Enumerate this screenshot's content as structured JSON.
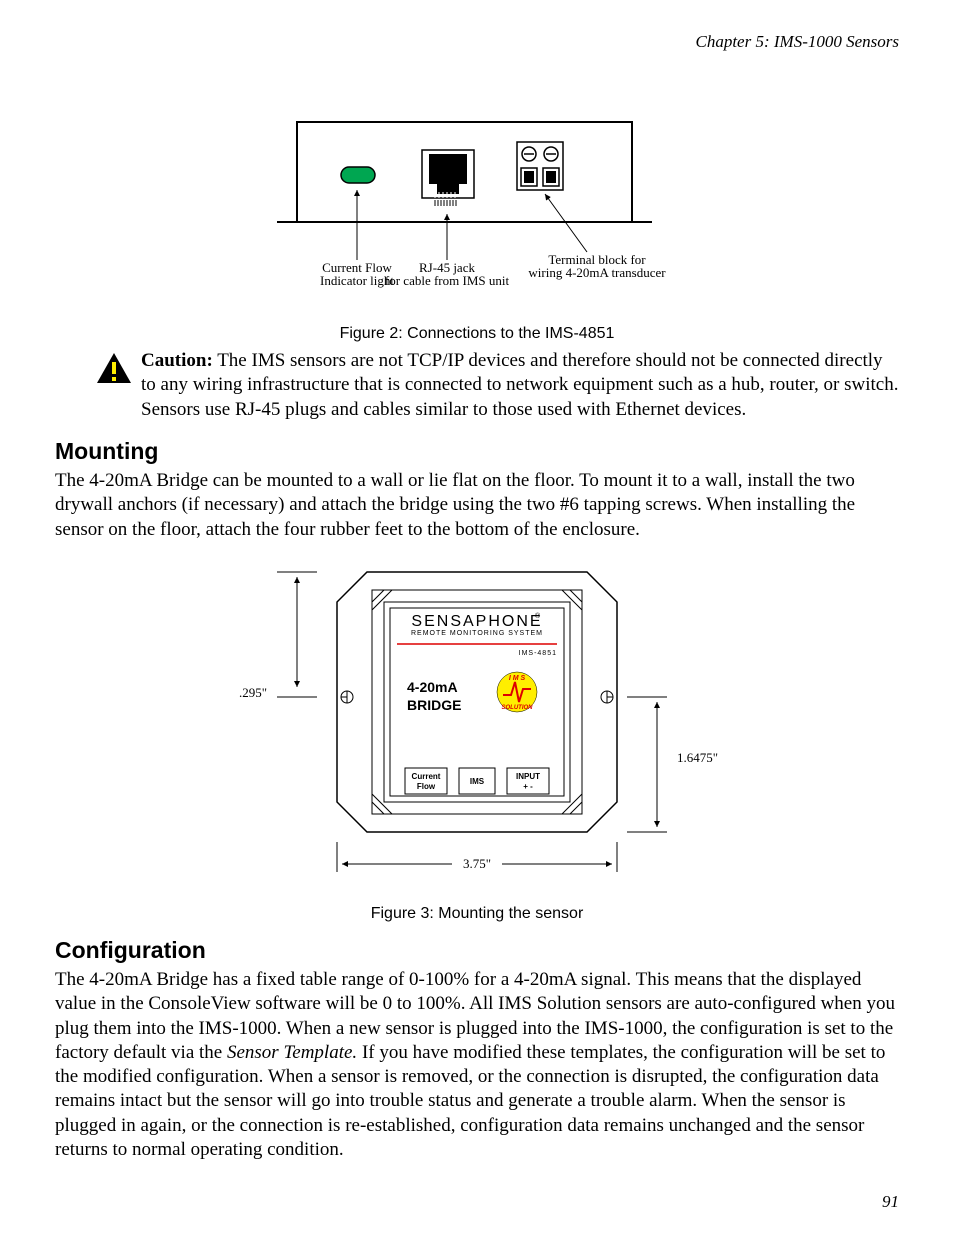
{
  "running_head": "Chapter 5: IMS-1000 Sensors",
  "figure2": {
    "caption": "Figure 2: Connections to the IMS-4851",
    "labels": {
      "left1": "Current Flow",
      "left2": "Indicator light",
      "mid1": "RJ-45 jack",
      "mid2": "for cable from IMS unit",
      "right1": "Terminal block for",
      "right2": "wiring 4-20mA transducer"
    }
  },
  "caution": {
    "label": "Caution:",
    "text": " The IMS sensors are not TCP/IP devices and therefore should not be connected directly to any wiring infrastructure that is connected to network equipment such as a hub, router, or switch.  Sensors use RJ-45 plugs and cables similar to those used with Ethernet devices."
  },
  "mounting": {
    "heading": "Mounting",
    "body": "The 4-20mA Bridge can be mounted to a wall or lie flat on the floor. To mount it to a wall, install the two drywall anchors (if necessary) and attach the bridge using the two #6 tapping screws. When installing the sensor on the floor, attach the four rubber feet to the bottom of the enclosure."
  },
  "figure3": {
    "caption": "Figure 3: Mounting the sensor",
    "brand": "SENSAPHONE",
    "brand_reg": "®",
    "brand_sub": "REMOTE MONITORING SYSTEM",
    "model": "IMS-4851",
    "title1": "4-20mA",
    "title2": "BRIDGE",
    "port1a": "Current",
    "port1b": "Flow",
    "port2": "IMS",
    "port3a": "INPUT",
    "port3b": "+  -",
    "dim_left": ".295\"",
    "dim_right": "1.6475\"",
    "dim_bottom": "3.75\"",
    "logo_top": "I M S",
    "logo_bottom": "SOLUTION"
  },
  "configuration": {
    "heading": "Configuration",
    "body_pre": "The 4-20mA Bridge has a fixed table range of 0-100% for a 4-20mA signal.  This means that the displayed value in the ConsoleView software will be 0 to 100%.  All IMS Solution sensors are auto-configured when you plug them into the IMS-1000.  When a new sensor is plugged into the IMS-1000, the configuration is set to the factory default via the ",
    "body_em": "Sensor Template.",
    "body_post": "  If you have modified these templates, the configuration will be set to the modified configuration.  When a sensor is removed, or the connection is disrupted, the configuration data remains intact but the sensor will go into trouble status and generate a trouble alarm.  When the sensor is plugged in again, or the connection is re-established, configuration data remains unchanged and the sensor returns to normal operating condition."
  },
  "page_number": "91"
}
